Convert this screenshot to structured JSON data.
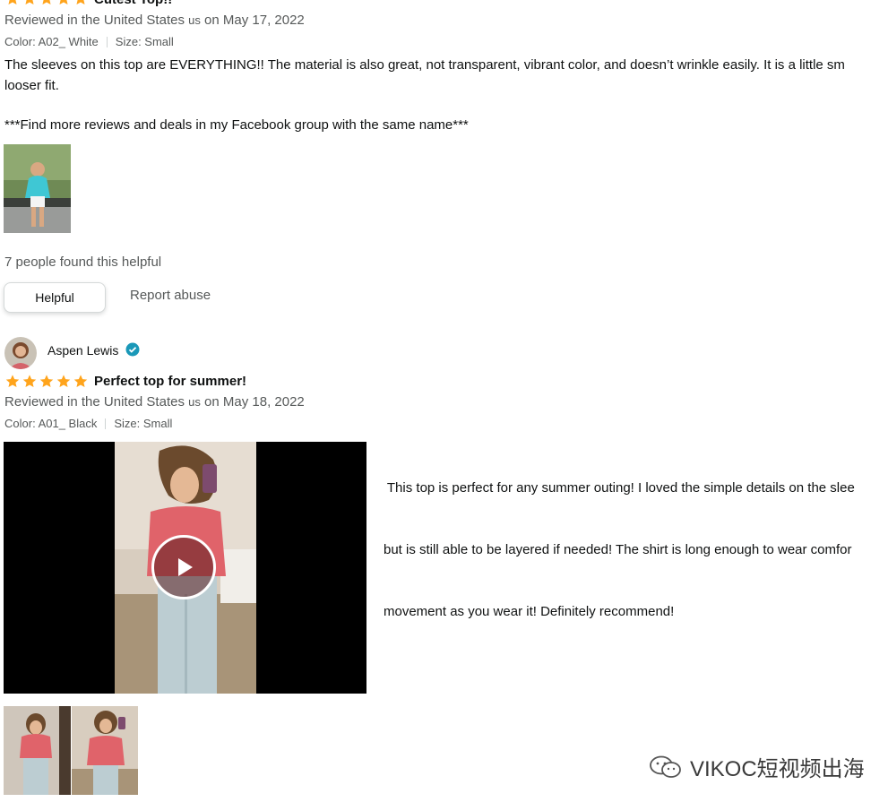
{
  "review1": {
    "title": "Cutest Top!!",
    "meta_prefix": "Reviewed in the United States",
    "meta_country": "us",
    "meta_suffix": "on May 17, 2022",
    "color": "Color: A02_ White",
    "size": "Size: Small",
    "text_line1": "The sleeves on this top are EVERYTHING!! The material is also great, not transparent, vibrant color, and doesn’t wrinkle easily. It is a little sm",
    "text_line2": "looser fit.",
    "text_line3": "***Find more reviews and deals in my Facebook group with the same name***",
    "helpful_count": "7 people found this helpful",
    "helpful_button": "Helpful",
    "report_link": "Report abuse"
  },
  "review2": {
    "reviewer": "Aspen Lewis",
    "title": "Perfect top for summer!",
    "meta_prefix": "Reviewed in the United States",
    "meta_country": "us",
    "meta_suffix": "on May 18, 2022",
    "color": "Color: A01_ Black",
    "size": "Size: Small",
    "text_line1": " This top is perfect for any summer outing! I loved the simple details on the slee",
    "text_line2": "but is still able to be layered if needed! The shirt is long enough to wear comfor",
    "text_line3": "movement as you wear it! Definitely recommend!"
  },
  "watermark": {
    "text": "VIKOC短视频出海"
  },
  "colors": {
    "star": "#ffa41c",
    "verified": "#1a98b8",
    "link": "#565959"
  }
}
